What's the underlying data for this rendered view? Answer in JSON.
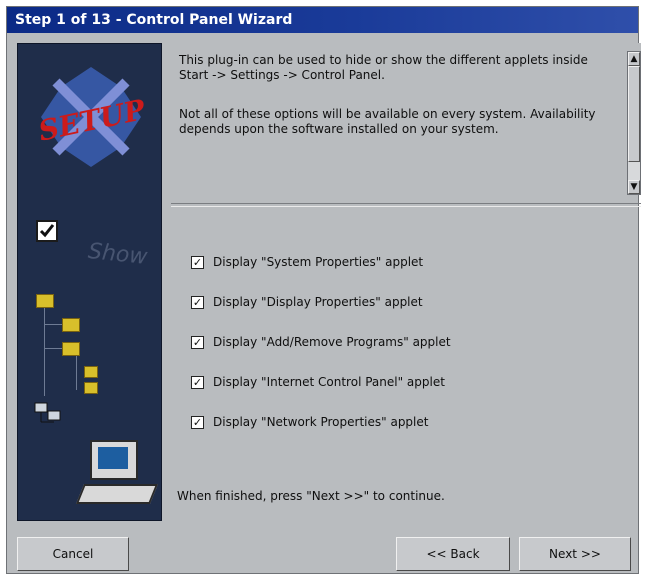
{
  "window": {
    "title": "Step 1 of 13 - Control Panel Wizard"
  },
  "intro": {
    "paragraph1": "This plug-in can be used to hide or show the different applets inside Start -> Settings -> Control Panel.",
    "paragraph2": "Not all of these options will be available on every system. Availability depends upon the software installed on your system."
  },
  "sidebar": {
    "logo_text": "SETUP",
    "ghost_text": "Show"
  },
  "options": [
    {
      "label": "Display \"System Properties\" applet",
      "checked": true
    },
    {
      "label": "Display \"Display Properties\" applet",
      "checked": true
    },
    {
      "label": "Display \"Add/Remove Programs\" applet",
      "checked": true
    },
    {
      "label": "Display \"Internet Control Panel\" applet",
      "checked": true
    },
    {
      "label": "Display \"Network Properties\" applet",
      "checked": true
    }
  ],
  "footer": {
    "finish_text": "When finished, press \"Next >>\" to continue."
  },
  "buttons": {
    "cancel": "Cancel",
    "back": "<< Back",
    "next": "Next >>"
  },
  "colors": {
    "titlebar": "#0b2a86",
    "dialog_bg": "#b9bcbf",
    "sidebar_bg": "#1f2d4a"
  }
}
